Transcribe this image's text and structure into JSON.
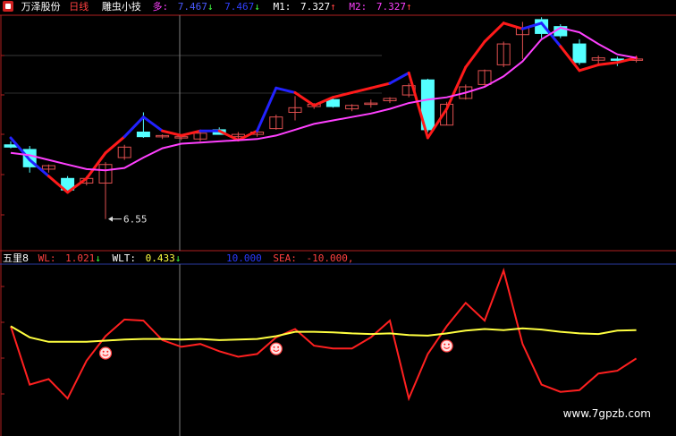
{
  "header": {
    "icon_name": "tdx-logo-icon",
    "stock_name": "万泽股份",
    "period": "日线",
    "indicator_name": "雕虫小技",
    "duo_label": "多:",
    "duo_value": "7.467",
    "duo_arrow": "↓",
    "duo2_value": "7.467",
    "duo2_arrow": "↓",
    "m1_label": "M1:",
    "m1_value": "7.327",
    "m1_arrow": "↑",
    "m2_label": "M2:",
    "m2_value": "7.327",
    "m2_arrow": "↑"
  },
  "lower_header": {
    "name": "五里8",
    "wl_label": "WL:",
    "wl_value": "1.021",
    "wl_arrow": "↓",
    "wlt_label": "WLT:",
    "wlt_value": "0.433",
    "wlt_arrow": "↓",
    "third_value": "10.000",
    "sea_label": "SEA:",
    "sea_value": "-10.000,"
  },
  "annotation": {
    "low_price_label": "6.55"
  },
  "watermark": "www.7gpzb.com",
  "colors": {
    "background": "#000000",
    "up_candle": "#e05050",
    "down_candle": "#54ffff",
    "pink_line": "#ff40ff",
    "trend_red": "#ff1a1a",
    "trend_blue": "#2222ff",
    "wl_line": "#ff2020",
    "wlt_line": "#ffff40",
    "divider": "#2a3aa0",
    "axis": "#b02020",
    "crosshair": "#808080"
  },
  "chart_data": [
    {
      "type": "candlestick",
      "ylim": [
        6.3,
        8.3
      ],
      "candles": [
        {
          "o": 7.19,
          "h": 7.22,
          "l": 7.16,
          "c": 7.17
        },
        {
          "o": 7.15,
          "h": 7.18,
          "l": 6.95,
          "c": 7.0
        },
        {
          "o": 6.98,
          "h": 7.02,
          "l": 6.95,
          "c": 7.01
        },
        {
          "o": 6.9,
          "h": 6.92,
          "l": 6.78,
          "c": 6.8
        },
        {
          "o": 6.86,
          "h": 6.92,
          "l": 6.84,
          "c": 6.9
        },
        {
          "o": 6.86,
          "h": 7.04,
          "l": 6.55,
          "c": 7.02
        },
        {
          "o": 7.08,
          "h": 7.19,
          "l": 7.06,
          "c": 7.17
        },
        {
          "o": 7.3,
          "h": 7.47,
          "l": 7.25,
          "c": 7.26
        },
        {
          "o": 7.26,
          "h": 7.28,
          "l": 7.24,
          "c": 7.27
        },
        {
          "o": 7.25,
          "h": 7.27,
          "l": 7.23,
          "c": 7.26
        },
        {
          "o": 7.24,
          "h": 7.3,
          "l": 7.22,
          "c": 7.29
        },
        {
          "o": 7.32,
          "h": 7.34,
          "l": 7.28,
          "c": 7.28
        },
        {
          "o": 7.26,
          "h": 7.3,
          "l": 7.24,
          "c": 7.28
        },
        {
          "o": 7.28,
          "h": 7.31,
          "l": 7.26,
          "c": 7.3
        },
        {
          "o": 7.33,
          "h": 7.45,
          "l": 7.32,
          "c": 7.43
        },
        {
          "o": 7.47,
          "h": 7.61,
          "l": 7.4,
          "c": 7.51
        },
        {
          "o": 7.52,
          "h": 7.55,
          "l": 7.5,
          "c": 7.54
        },
        {
          "o": 7.58,
          "h": 7.6,
          "l": 7.51,
          "c": 7.52
        },
        {
          "o": 7.5,
          "h": 7.54,
          "l": 7.48,
          "c": 7.53
        },
        {
          "o": 7.54,
          "h": 7.58,
          "l": 7.51,
          "c": 7.55
        },
        {
          "o": 7.57,
          "h": 7.6,
          "l": 7.55,
          "c": 7.59
        },
        {
          "o": 7.62,
          "h": 7.72,
          "l": 7.6,
          "c": 7.7
        },
        {
          "o": 7.75,
          "h": 7.76,
          "l": 7.3,
          "c": 7.32
        },
        {
          "o": 7.36,
          "h": 7.56,
          "l": 7.36,
          "c": 7.54
        },
        {
          "o": 7.59,
          "h": 7.71,
          "l": 7.58,
          "c": 7.69
        },
        {
          "o": 7.71,
          "h": 7.84,
          "l": 7.7,
          "c": 7.83
        },
        {
          "o": 7.88,
          "h": 8.08,
          "l": 7.86,
          "c": 8.06
        },
        {
          "o": 8.14,
          "h": 8.25,
          "l": 7.93,
          "c": 8.2
        },
        {
          "o": 8.27,
          "h": 8.29,
          "l": 8.11,
          "c": 8.15
        },
        {
          "o": 8.21,
          "h": 8.23,
          "l": 8.11,
          "c": 8.13
        },
        {
          "o": 8.06,
          "h": 8.1,
          "l": 7.88,
          "c": 7.9
        },
        {
          "o": 7.92,
          "h": 7.96,
          "l": 7.88,
          "c": 7.94
        },
        {
          "o": 7.93,
          "h": 7.95,
          "l": 7.87,
          "c": 7.92
        },
        {
          "o": 7.92,
          "h": 7.96,
          "l": 7.9,
          "c": 7.93
        }
      ],
      "pink_ma": [
        7.12,
        7.1,
        7.06,
        7.02,
        6.98,
        6.97,
        6.99,
        7.08,
        7.16,
        7.2,
        7.21,
        7.22,
        7.23,
        7.24,
        7.27,
        7.32,
        7.37,
        7.4,
        7.43,
        7.46,
        7.5,
        7.55,
        7.58,
        7.6,
        7.64,
        7.69,
        7.78,
        7.91,
        8.1,
        8.2,
        8.16,
        8.06,
        7.97,
        7.94
      ],
      "trend_line": [
        {
          "i": 0,
          "v": 7.25,
          "dir": "down"
        },
        {
          "i": 1,
          "v": 7.06,
          "dir": "down"
        },
        {
          "i": 2,
          "v": 6.92,
          "dir": "down"
        },
        {
          "i": 3,
          "v": 6.78,
          "dir": "up"
        },
        {
          "i": 4,
          "v": 6.9,
          "dir": "up"
        },
        {
          "i": 5,
          "v": 7.12,
          "dir": "up"
        },
        {
          "i": 6,
          "v": 7.26,
          "dir": "up"
        },
        {
          "i": 7,
          "v": 7.43,
          "dir": "down"
        },
        {
          "i": 8,
          "v": 7.31,
          "dir": "down"
        },
        {
          "i": 9,
          "v": 7.27,
          "dir": "up"
        },
        {
          "i": 10,
          "v": 7.31,
          "dir": "up"
        },
        {
          "i": 11,
          "v": 7.31,
          "dir": "down"
        },
        {
          "i": 12,
          "v": 7.23,
          "dir": "up"
        },
        {
          "i": 13,
          "v": 7.31,
          "dir": "up"
        },
        {
          "i": 14,
          "v": 7.68,
          "dir": "down"
        },
        {
          "i": 15,
          "v": 7.64,
          "dir": "down"
        },
        {
          "i": 16,
          "v": 7.53,
          "dir": "up"
        },
        {
          "i": 17,
          "v": 7.6,
          "dir": "up"
        },
        {
          "i": 18,
          "v": 7.64,
          "dir": "up"
        },
        {
          "i": 19,
          "v": 7.68,
          "dir": "up"
        },
        {
          "i": 20,
          "v": 7.72,
          "dir": "up"
        },
        {
          "i": 21,
          "v": 7.81,
          "dir": "down"
        },
        {
          "i": 22,
          "v": 7.25,
          "dir": "up"
        },
        {
          "i": 23,
          "v": 7.5,
          "dir": "up"
        },
        {
          "i": 24,
          "v": 7.86,
          "dir": "up"
        },
        {
          "i": 25,
          "v": 8.08,
          "dir": "up"
        },
        {
          "i": 26,
          "v": 8.24,
          "dir": "up"
        },
        {
          "i": 27,
          "v": 8.19,
          "dir": "up"
        },
        {
          "i": 28,
          "v": 8.24,
          "dir": "down"
        },
        {
          "i": 29,
          "v": 8.04,
          "dir": "down"
        },
        {
          "i": 30,
          "v": 7.83,
          "dir": "up"
        },
        {
          "i": 31,
          "v": 7.88,
          "dir": "up"
        },
        {
          "i": 32,
          "v": 7.9,
          "dir": "up"
        },
        {
          "i": 33,
          "v": 7.94,
          "dir": "up"
        }
      ]
    },
    {
      "type": "line",
      "ylim": [
        -1.2,
        1.6
      ],
      "series": [
        {
          "name": "WL",
          "values": [
            0.5,
            -0.55,
            -0.45,
            -0.8,
            -0.12,
            0.32,
            0.62,
            0.6,
            0.25,
            0.13,
            0.18,
            0.05,
            -0.05,
            0.0,
            0.3,
            0.45,
            0.15,
            0.1,
            0.1,
            0.3,
            0.6,
            -0.8,
            0.0,
            0.5,
            0.92,
            0.6,
            1.5,
            0.18,
            -0.55,
            -0.68,
            -0.65,
            -0.35,
            -0.3,
            -0.08
          ]
        },
        {
          "name": "WLT",
          "values": [
            0.5,
            0.3,
            0.22,
            0.22,
            0.22,
            0.24,
            0.26,
            0.27,
            0.27,
            0.26,
            0.27,
            0.25,
            0.26,
            0.27,
            0.32,
            0.4,
            0.4,
            0.39,
            0.37,
            0.36,
            0.37,
            0.34,
            0.33,
            0.37,
            0.42,
            0.45,
            0.43,
            0.46,
            0.44,
            0.4,
            0.37,
            0.36,
            0.42,
            0.43
          ]
        }
      ],
      "smiley_indices": [
        5,
        14,
        23
      ]
    }
  ]
}
